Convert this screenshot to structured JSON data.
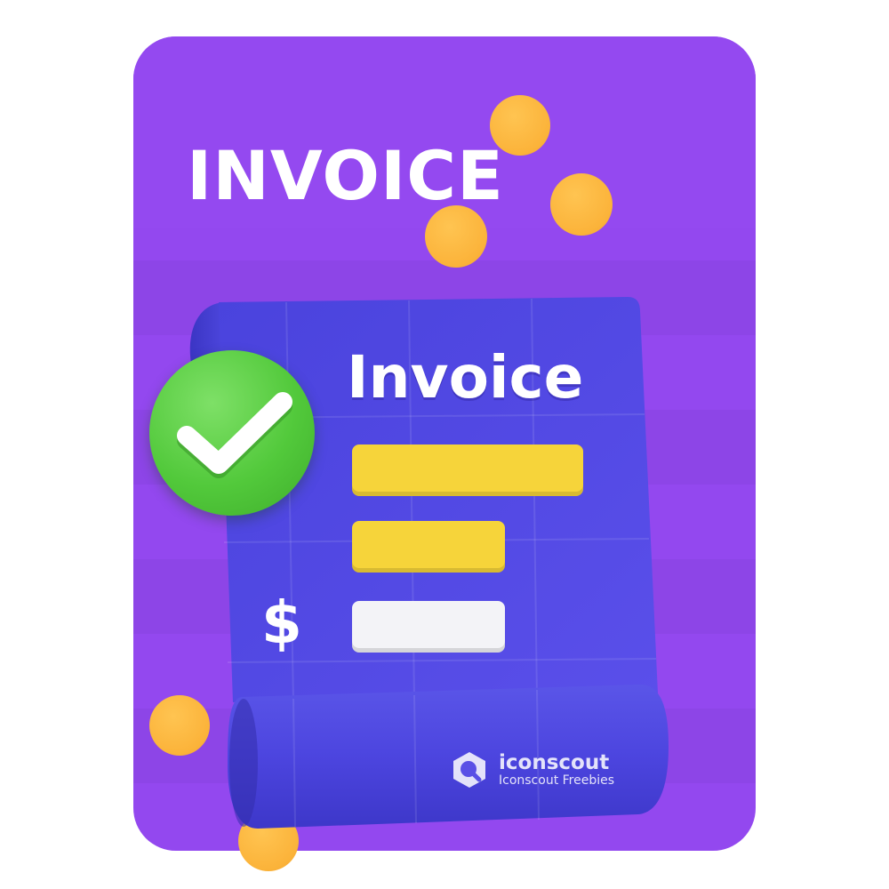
{
  "headline": "INVOICE",
  "document": {
    "title": "Invoice",
    "currency_symbol": "$"
  },
  "icons": {
    "badge": "checkmark-icon",
    "watermark_logo": "iconscout-logo-icon"
  },
  "watermark": {
    "brand": "iconscout",
    "subtitle": "Iconscout Freebies"
  },
  "colors": {
    "background": "#9348ef",
    "paper": "#4a44e0",
    "bar_primary": "#f6d43a",
    "bar_secondary": "#f3f3f7",
    "coin": "#fbb33a",
    "check_badge": "#52c93b"
  }
}
